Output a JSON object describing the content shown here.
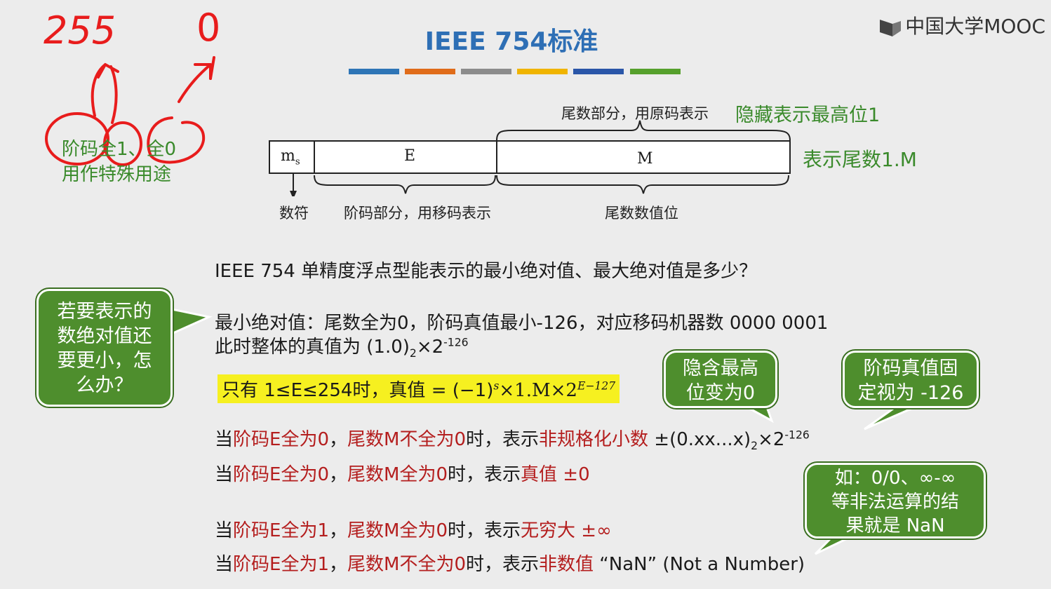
{
  "title": "IEEE 754标准",
  "logo_text": "中国大学MOOC",
  "stripe_colors": [
    "#2e75b6",
    "#e06c1a",
    "#8c8c8c",
    "#f0b400",
    "#2a56a8",
    "#56a02c"
  ],
  "format": {
    "ms": "m",
    "ms_sub": "s",
    "e": "E",
    "m": "M",
    "top_caption": "尾数部分，用原码表示",
    "hidden_bit_note": "隐藏表示最高位1",
    "mantissa_note": "表示尾数1.M",
    "sign_caption": "数符",
    "exp_caption": "阶码部分，用移码表示",
    "mant_caption": "尾数数值位"
  },
  "annotation": {
    "num_255": "255",
    "num_0": "0",
    "special_line1": "阶码全1、全0",
    "special_line2": "用作特殊用途"
  },
  "question": "IEEE 754 单精度浮点型能表示的最小绝对值、最大绝对值是多少？",
  "min_line1": "最小绝对值：尾数全为0，阶码真值最小-126，对应移码机器数 0000 0001",
  "min_line2_pre": "此时整体的真值为 (1.0)",
  "min_line2_sub": "2",
  "min_line2_mid": "×2",
  "min_line2_sup": "-126",
  "normal_rule": {
    "pre": "只有  1≤E≤254时，真值 = (−1)",
    "s": "s",
    "mid": "×1.M×2",
    "exp": "E−127"
  },
  "bubbles": {
    "smaller": [
      "若要表示的",
      "数绝对值还",
      "要更小，怎",
      "么办？"
    ],
    "hidden": [
      "隐含最高",
      "位变为0"
    ],
    "exp_fixed": [
      "阶码真值固",
      "定视为 -126"
    ],
    "nan": [
      "如：0/0、∞-∞",
      "等非法运算的结",
      "果就是 NaN"
    ]
  },
  "rules": [
    {
      "a": "当",
      "b": "阶码E全为0",
      "c": "，",
      "d": "尾数M不全为0",
      "e": "时，表示",
      "f": "非规格化小数",
      "g": " ±(0.xx...x)",
      "sub": "2",
      "h": "×2",
      "sup": "-126"
    },
    {
      "a": "当",
      "b": "阶码E全为0",
      "c": "，",
      "d": "尾数M全为0",
      "e": "时，表示",
      "f": "真值 ±0"
    },
    {
      "a": "当",
      "b": "阶码E全为1",
      "c": "，",
      "d": "尾数M全为0",
      "e": "时，表示",
      "f": "无穷大 ±∞"
    },
    {
      "a": "当",
      "b": "阶码E全为1",
      "c": "，",
      "d": "尾数M不全为0",
      "e": "时，表示",
      "f": "非数值",
      "g": " “NaN” (Not a Number)"
    }
  ]
}
